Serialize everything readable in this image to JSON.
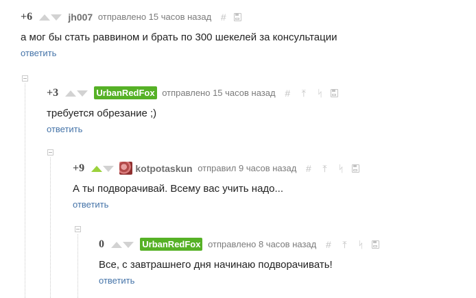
{
  "comments": [
    {
      "rating": "+6",
      "author": "jh007",
      "posted": "отправлено 15 часов назад",
      "text": "а мог бы стать раввином и брать по 300 шекелей за консультации",
      "reply": "ответить",
      "upvoted": false,
      "badge": false,
      "avatar": false
    },
    {
      "rating": "+3",
      "author": "UrbanRedFox",
      "posted": "отправлено 15 часов назад",
      "text": "требуется обрезание ;)",
      "reply": "ответить",
      "upvoted": false,
      "badge": true,
      "avatar": false
    },
    {
      "rating": "+9",
      "author": "kotpotaskun",
      "posted": "отправил 9 часов назад",
      "text": "А ты подворачивай. Всему вас учить надо...",
      "reply": "ответить",
      "upvoted": true,
      "badge": false,
      "avatar": true
    },
    {
      "rating": "0",
      "author": "UrbanRedFox",
      "posted": "отправлено 8 часов назад",
      "text": "Все, с завтрашнего дня начинаю подворачивать!",
      "reply": "ответить",
      "upvoted": false,
      "badge": true,
      "avatar": false
    }
  ],
  "icons": {
    "link": "#",
    "parent": "⤒",
    "branch": "ᛋ",
    "save": "save-icon"
  },
  "colors": {
    "badge": "#56b126",
    "upvote_active": "#9bd23c",
    "link": "#4473a8"
  }
}
